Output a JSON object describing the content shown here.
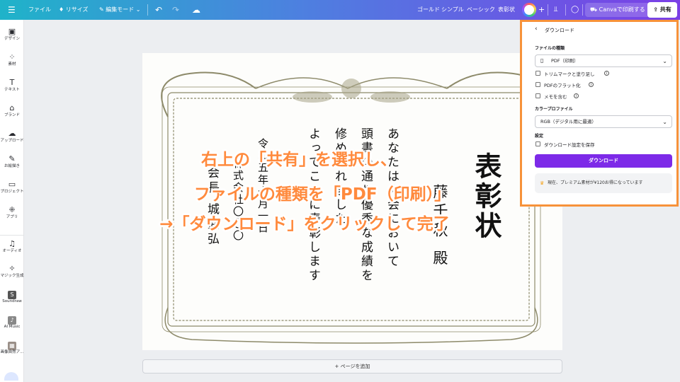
{
  "topbar": {
    "menu_icon": "hamburger-icon",
    "file_label": "ファイル",
    "resize_label": "リサイズ",
    "edit_mode_label": "編集モード",
    "undo_icon": "undo-icon",
    "redo_icon": "redo-icon",
    "cloud_icon": "cloud-sync-icon",
    "template_tabs": [
      "ゴールド",
      "シンプル",
      "ベーシック",
      "表彰状"
    ],
    "print_label": "Canvaで印刷する",
    "share_label": "共有"
  },
  "sidebar": {
    "items": [
      {
        "label": "デザイン",
        "icon": "design-icon"
      },
      {
        "label": "素材",
        "icon": "elements-icon"
      },
      {
        "label": "テキスト",
        "icon": "text-icon"
      },
      {
        "label": "ブランド",
        "icon": "brand-icon"
      },
      {
        "label": "アップロード",
        "icon": "upload-icon"
      },
      {
        "label": "お絵描き",
        "icon": "draw-icon"
      },
      {
        "label": "プロジェクト",
        "icon": "projects-icon"
      },
      {
        "label": "アプリ",
        "icon": "apps-icon"
      },
      {
        "label": "オーディオ",
        "icon": "audio-icon"
      },
      {
        "label": "マジック生成",
        "icon": "magic-media-icon"
      },
      {
        "label": "Soundraw",
        "icon": "soundraw-icon"
      },
      {
        "label": "AI Music",
        "icon": "ai-music-icon"
      },
      {
        "label": "画像自然ア...",
        "icon": "app-image-icon"
      }
    ]
  },
  "certificate": {
    "title": "表彰状",
    "recipient": "藤千秋 殿",
    "body_lines": [
      "あなたは大会において",
      "頭書の通り優秀な成績を",
      "修められました",
      "よってここに表彰します"
    ],
    "date_line": "令和五年十月一日",
    "org_line": "株式会社〇〇〇",
    "signer_line": "会長 城武弘"
  },
  "add_page_label": "+ ページを追加",
  "overlay": {
    "line1": "右上の「共有」を選択し、",
    "line2": "ファイルの種類を「PDF（印刷）」",
    "line3": "→「ダウンロード」をクリックして完了",
    "color": "#ff8a3d"
  },
  "download_panel": {
    "back_icon": "chevron-left-icon",
    "title": "ダウンロード",
    "file_type_label": "ファイルの種類",
    "file_type_value": "PDF（印刷）",
    "options": [
      {
        "label": "トリムマークと塗り足し",
        "checked": false,
        "info": true
      },
      {
        "label": "PDFのフラット化",
        "checked": false,
        "info": true
      },
      {
        "label": "メモを含む",
        "checked": false,
        "info": true
      }
    ],
    "color_profile_label": "カラープロファイル",
    "color_profile_value": "RGB（デジタル用に最適）",
    "settings_label": "設定",
    "save_settings_label": "ダウンロード設定を保存",
    "download_button": "ダウンロード",
    "premium_note": "現在、プレミアム素材が¥120お得になっています",
    "accent": "#7d2ae8",
    "highlight_border": "#f7923a"
  }
}
